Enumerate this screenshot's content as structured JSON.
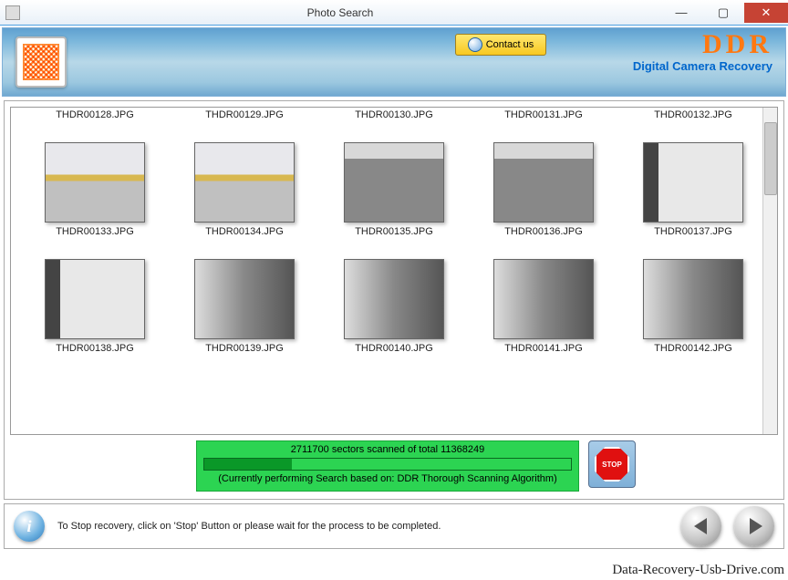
{
  "window": {
    "title": "Photo Search"
  },
  "header": {
    "contact_label": "Contact us",
    "brand": "DDR",
    "brand_sub": "Digital Camera Recovery"
  },
  "thumbs": {
    "row0": [
      "THDR00128.JPG",
      "THDR00129.JPG",
      "THDR00130.JPG",
      "THDR00131.JPG",
      "THDR00132.JPG"
    ],
    "row1": [
      "THDR00133.JPG",
      "THDR00134.JPG",
      "THDR00135.JPG",
      "THDR00136.JPG",
      "THDR00137.JPG"
    ],
    "row2": [
      "THDR00138.JPG",
      "THDR00139.JPG",
      "THDR00140.JPG",
      "THDR00141.JPG",
      "THDR00142.JPG"
    ]
  },
  "progress": {
    "sectors_text": "2711700 sectors scanned of total 11368249",
    "algorithm_text": "(Currently performing Search based on:  DDR Thorough Scanning Algorithm)",
    "stop_label": "STOP"
  },
  "footer": {
    "hint": "To Stop recovery, click on 'Stop' Button or please wait for the process to be completed."
  },
  "watermark": "Data-Recovery-Usb-Drive.com"
}
